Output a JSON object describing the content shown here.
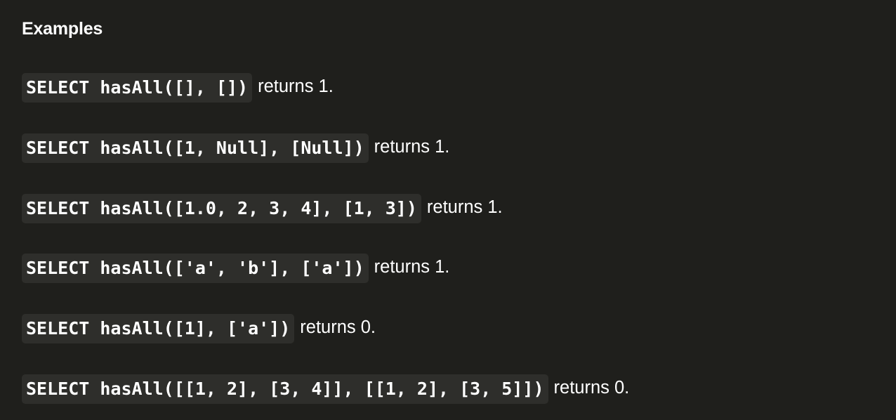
{
  "section": {
    "heading": "Examples"
  },
  "examples": [
    {
      "code": "SELECT hasAll([], [])",
      "result": "returns 1."
    },
    {
      "code": "SELECT hasAll([1, Null], [Null])",
      "result": "returns 1."
    },
    {
      "code": "SELECT hasAll([1.0, 2, 3, 4], [1, 3])",
      "result": "returns 1."
    },
    {
      "code": "SELECT hasAll(['a', 'b'], ['a'])",
      "result": "returns 1."
    },
    {
      "code": "SELECT hasAll([1], ['a'])",
      "result": "returns 0."
    },
    {
      "code": "SELECT hasAll([[1, 2], [3, 4]], [[1, 2], [3, 5]])",
      "result": "returns 0."
    }
  ]
}
